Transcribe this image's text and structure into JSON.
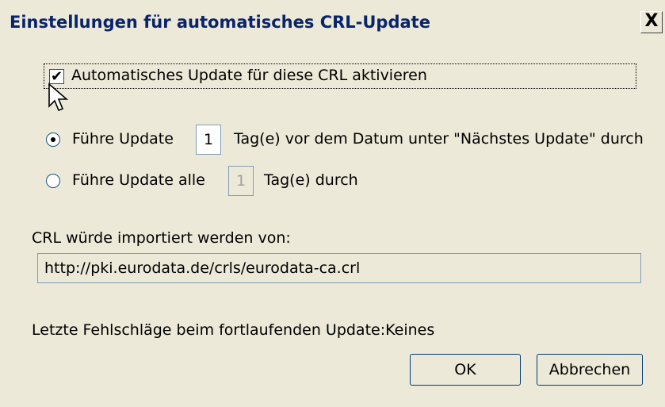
{
  "dialog": {
    "title": "Einstellungen für automatisches CRL-Update",
    "close_glyph": "X",
    "auto_update": {
      "checked": true,
      "check_glyph": "✔",
      "label": "Automatisches Update für diese CRL aktivieren"
    },
    "option1": {
      "selected": true,
      "prefix": "Führe Update",
      "value": "1",
      "suffix": "Tag(e) vor dem Datum unter \"Nächstes Update\" durch"
    },
    "option2": {
      "selected": false,
      "prefix": "Führe Update alle",
      "value": "1",
      "suffix": "Tag(e) durch"
    },
    "import_label": "CRL würde importiert werden von:",
    "import_url": "http://pki.eurodata.de/crls/eurodata-ca.crl",
    "last_failures": "Letzte Fehlschläge beim fortlaufenden Update:Keines",
    "ok_label": "OK",
    "cancel_label": "Abbrechen"
  }
}
